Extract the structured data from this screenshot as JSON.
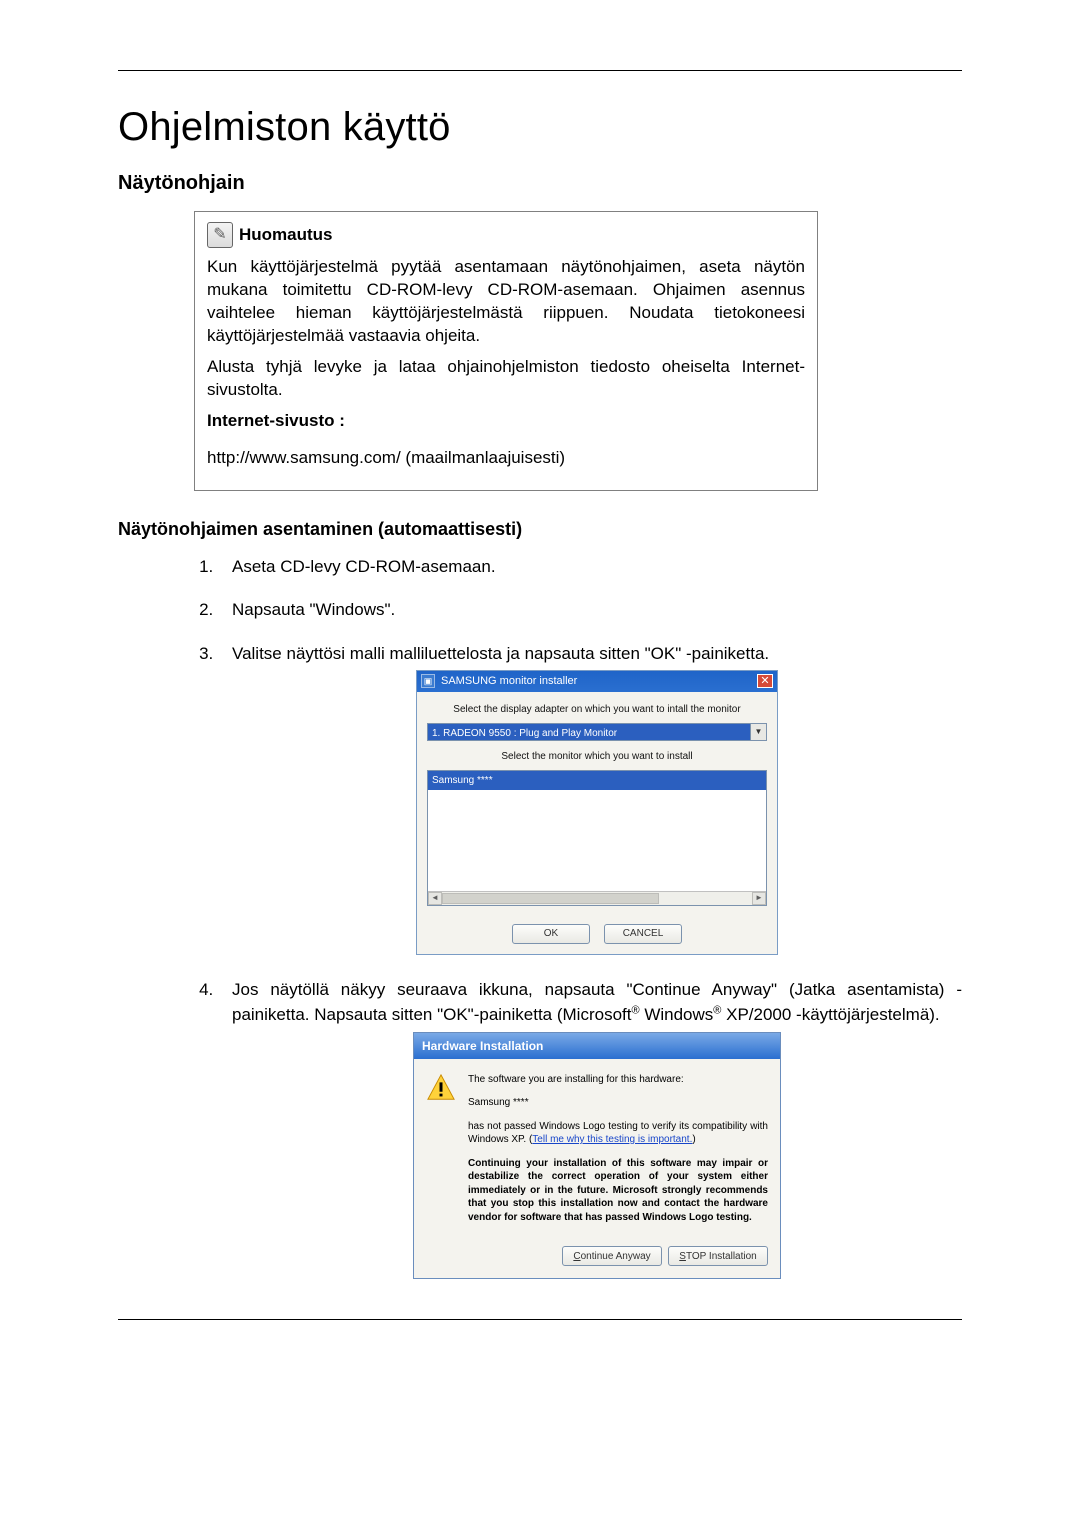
{
  "title": "Ohjelmiston käyttö",
  "section1": "Näytönohjain",
  "note": {
    "label": "Huomautus",
    "p1": "Kun käyttöjärjestelmä pyytää asentamaan näytönohjaimen, aseta näytön mukana toimitettu CD-ROM-levy CD-ROM-asemaan. Ohjaimen asennus vaihtelee hieman käyttöjärjestelmästä riippuen. Noudata tietokoneesi käyttöjärjestelmää vastaavia ohjeita.",
    "p2": "Alusta tyhjä levyke ja lataa ohjainohjelmiston tiedosto oheiselta Internet-sivustolta.",
    "ilabel": "Internet-sivusto :",
    "url": "http://www.samsung.com/ (maailmanlaajuisesti)"
  },
  "section2": "Näytönohjaimen asentaminen (automaattisesti)",
  "steps": {
    "s1": "Aseta CD-levy CD-ROM-asemaan.",
    "s2": "Napsauta \"Windows\".",
    "s3": "Valitse näyttösi malli malliluettelosta ja napsauta sitten \"OK\" -painiketta.",
    "s4a": "Jos näytöllä näkyy seuraava ikkuna, napsauta \"Continue Anyway\" (Jatka asentamista) -painiketta. Napsauta sitten \"OK\"-painiketta (Microsoft",
    "s4b": " Windows",
    "s4c": " XP/2000 -käyttöjärjestelmä)."
  },
  "dlg1": {
    "title": "SAMSUNG monitor installer",
    "label1": "Select the display adapter on which you want to intall the monitor",
    "combo": "1. RADEON 9550 : Plug and Play Monitor",
    "label2": "Select the monitor which you want to install",
    "listsel": "Samsung ****",
    "ok": "OK",
    "cancel": "CANCEL"
  },
  "dlg2": {
    "title": "Hardware Installation",
    "p1": "The software you are installing for this hardware:",
    "p2": "Samsung ****",
    "p3a": "has not passed Windows Logo testing to verify its compatibility with Windows XP. (",
    "link": "Tell me why this testing is important.",
    "p3b": ")",
    "bold": "Continuing your installation of this software may impair or destabilize the correct operation of your system either immediately or in the future. Microsoft strongly recommends that you stop this installation now and contact the hardware vendor for software that has passed Windows Logo testing.",
    "btn1": "Continue Anyway",
    "btn2": "STOP Installation"
  }
}
